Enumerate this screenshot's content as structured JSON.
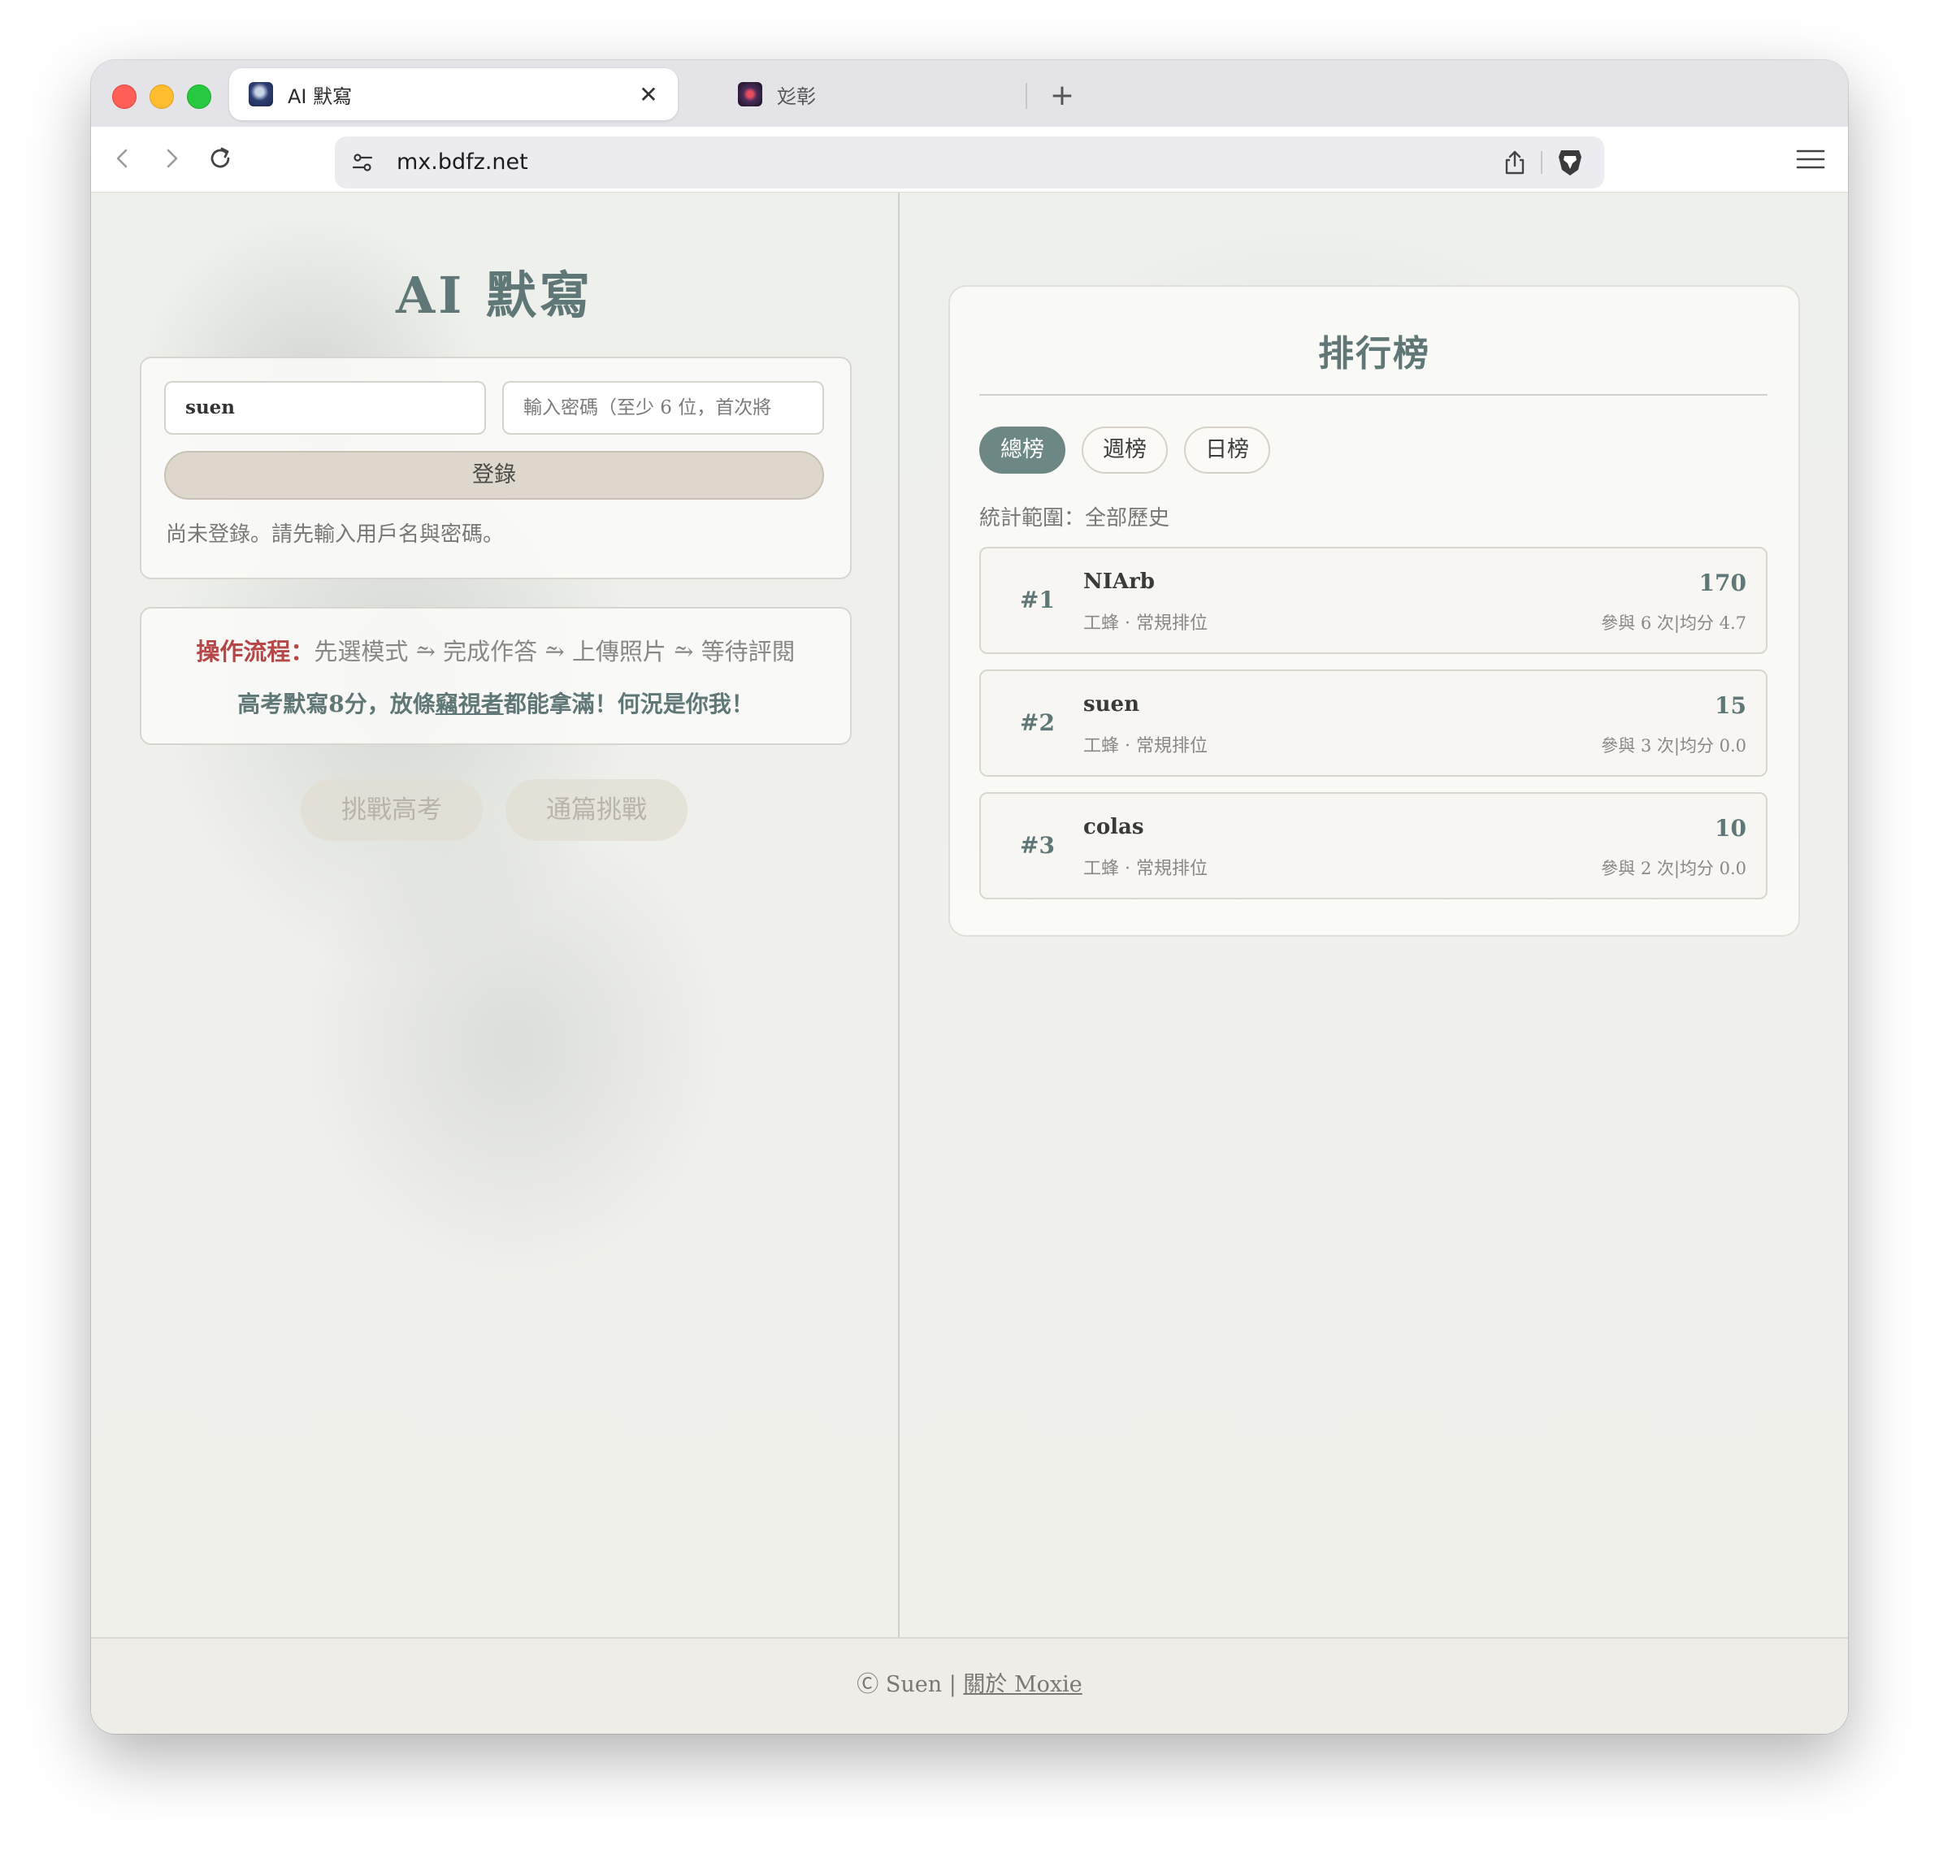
{
  "browser": {
    "tabs": [
      {
        "title": "AI 默寫",
        "active": true,
        "favicon": "app-favicon"
      },
      {
        "title": "彣彰",
        "active": false,
        "favicon": "site-favicon"
      }
    ],
    "close_glyph": "✕",
    "new_tab_glyph": "+",
    "url": "mx.bdfz.net"
  },
  "app": {
    "title": "AI 默寫"
  },
  "login": {
    "username_value": "suen",
    "password_placeholder": "輸入密碼（至少 6 位，首次將",
    "login_button": "登錄",
    "status": "尚未登錄。請先輸入用戶名與密碼。"
  },
  "flow": {
    "label": "操作流程：",
    "steps": "先選模式 ⥲ 完成作答 ⥲ 上傳照片 ⥲ 等待評閱",
    "slogan_prefix": "高考默寫8分，放條",
    "slogan_link": "竊視者",
    "slogan_suffix": "都能拿滿！何況是你我！"
  },
  "modes": {
    "gaokao": "挑戰高考",
    "full": "通篇挑戰"
  },
  "leaderboard": {
    "title": "排行榜",
    "tabs": [
      "總榜",
      "週榜",
      "日榜"
    ],
    "active_tab": "總榜",
    "scope": "統計範圍：全部歷史",
    "rows": [
      {
        "rank": "#1",
        "name": "NIArb",
        "meta": "工蜂 · 常規排位",
        "score": "170",
        "stats": "參與 6 次|均分 4.7"
      },
      {
        "rank": "#2",
        "name": "suen",
        "meta": "工蜂 · 常規排位",
        "score": "15",
        "stats": "參與 3 次|均分 0.0"
      },
      {
        "rank": "#3",
        "name": "colas",
        "meta": "工蜂 · 常規排位",
        "score": "10",
        "stats": "參與 2 次|均分 0.0"
      }
    ]
  },
  "footer": {
    "copyright": "Ⓒ Suen",
    "separator": "|",
    "about_link": "關於 Moxie"
  },
  "colors": {
    "accent": "#5f7877",
    "active_tab": "#6d8785",
    "flow_label": "#b54747",
    "login_button": "#ded8cc"
  }
}
